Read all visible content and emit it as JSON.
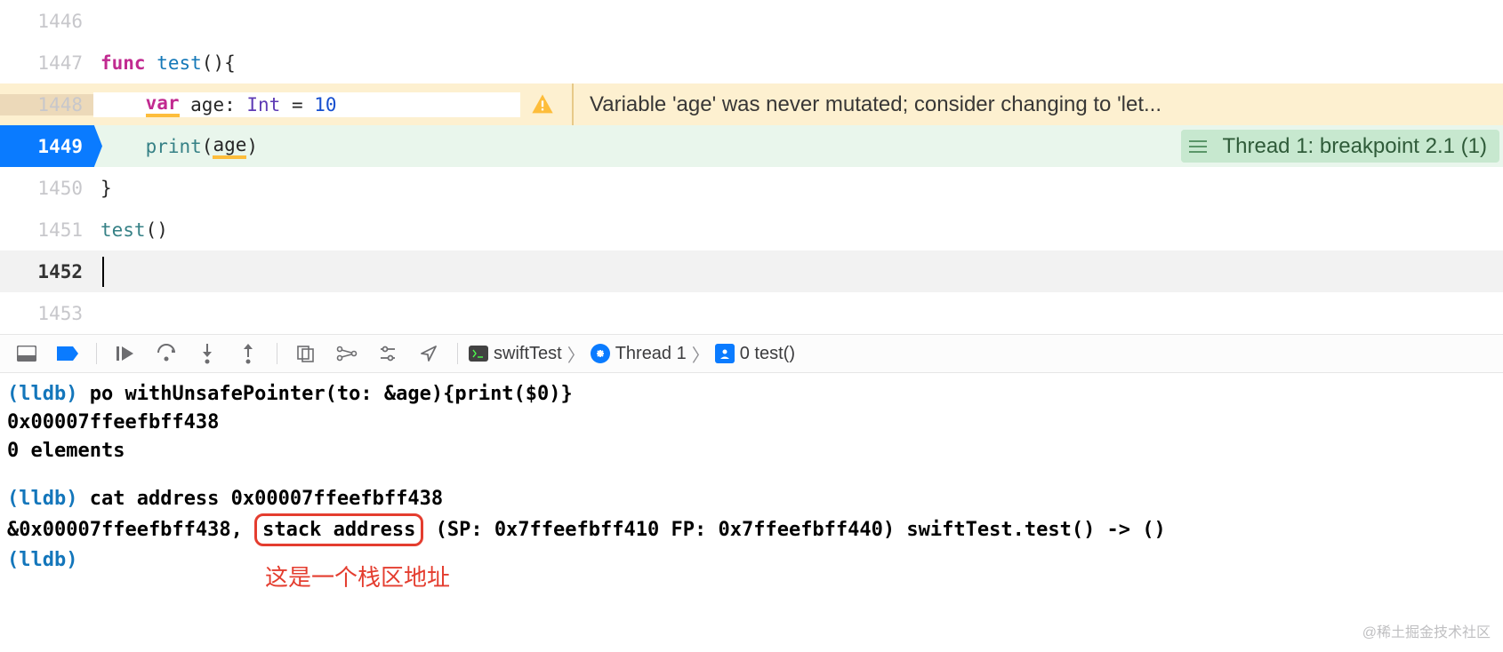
{
  "lines": {
    "l1446": "1446",
    "l1447": "1447",
    "l1448": "1448",
    "l1449": "1449",
    "l1450": "1450",
    "l1451": "1451",
    "l1452": "1452",
    "l1453": "1453"
  },
  "code": {
    "func_kw": "func",
    "test_name": " test",
    "paren_open_brace": "(){",
    "var_kw": "var",
    "age_ident": " age",
    "colon": ": ",
    "int_type": "Int",
    "equals": " = ",
    "ten": "10",
    "print_call": "print",
    "open_paren": "(",
    "age_arg": "age",
    "close_paren": ")",
    "close_brace": "}",
    "test_call": "test",
    "test_call_parens": "()"
  },
  "warning": {
    "text": "Variable 'age' was never mutated; consider changing to 'let..."
  },
  "thread_banner": {
    "text": "Thread 1: breakpoint 2.1 (1)"
  },
  "crumbs": {
    "target": "swiftTest",
    "thread": "Thread 1",
    "frame": "0 test()"
  },
  "console": {
    "prompt": "(lldb)",
    "cmd1": " po withUnsafePointer(to: &age){print($0)}",
    "out1a": "0x00007ffeefbff438",
    "out1b": "0 elements",
    "cmd2": " cat address 0x00007ffeefbff438",
    "out2_pre": "&0x00007ffeefbff438, ",
    "out2_box": "stack address",
    "out2_post": " (SP: 0x7ffeefbff410 FP: 0x7ffeefbff440) swiftTest.test() -> ()",
    "annotation": "这是一个栈区地址",
    "watermark": "@稀土掘金技术社区"
  }
}
